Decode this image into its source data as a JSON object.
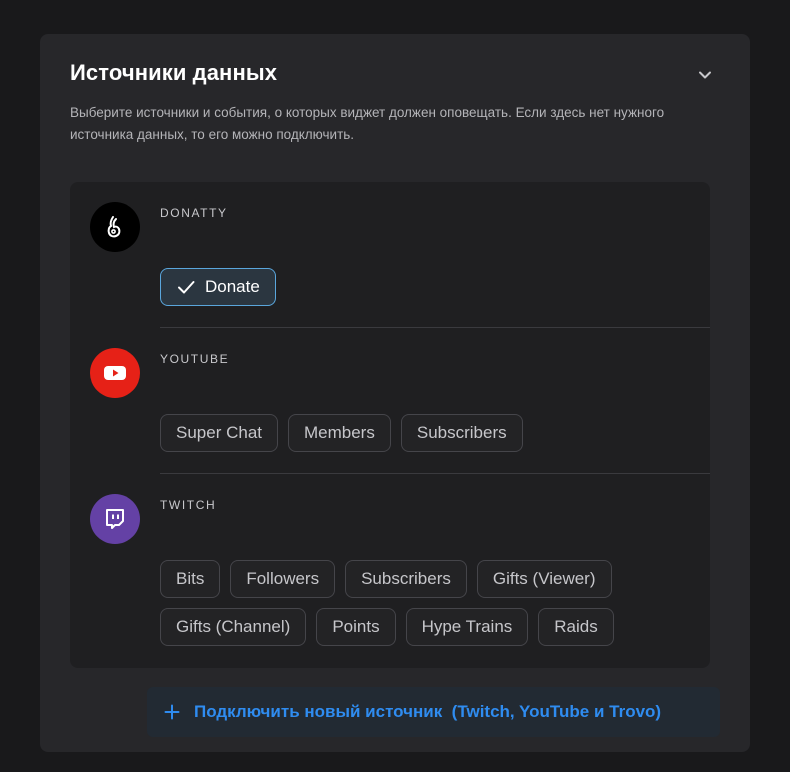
{
  "panel": {
    "title": "Источники данных",
    "description": "Выберите источники и события, о которых виджет должен оповещать. Если здесь нет нужного источника данных, то его можно подключить."
  },
  "sources": [
    {
      "name": "DONATTY",
      "icon": "donatty-logo-icon",
      "color": "#000000",
      "events": [
        {
          "label": "Donate",
          "selected": true
        }
      ]
    },
    {
      "name": "YOUTUBE",
      "icon": "youtube-logo-icon",
      "color": "#e62117",
      "events": [
        {
          "label": "Super Chat",
          "selected": false
        },
        {
          "label": "Members",
          "selected": false
        },
        {
          "label": "Subscribers",
          "selected": false
        }
      ]
    },
    {
      "name": "TWITCH",
      "icon": "twitch-logo-icon",
      "color": "#6441a5",
      "events": [
        {
          "label": "Bits",
          "selected": false
        },
        {
          "label": "Followers",
          "selected": false
        },
        {
          "label": "Subscribers",
          "selected": false
        },
        {
          "label": "Gifts (Viewer)",
          "selected": false
        },
        {
          "label": "Gifts (Channel)",
          "selected": false
        },
        {
          "label": "Points",
          "selected": false
        },
        {
          "label": "Hype Trains",
          "selected": false
        },
        {
          "label": "Raids",
          "selected": false
        }
      ]
    }
  ],
  "connect": {
    "label": "Подключить новый источник  (Twitch, YouTube и Trovo)"
  },
  "colors": {
    "accent": "#2f8cf0",
    "selected_border": "#5aa6dc"
  }
}
